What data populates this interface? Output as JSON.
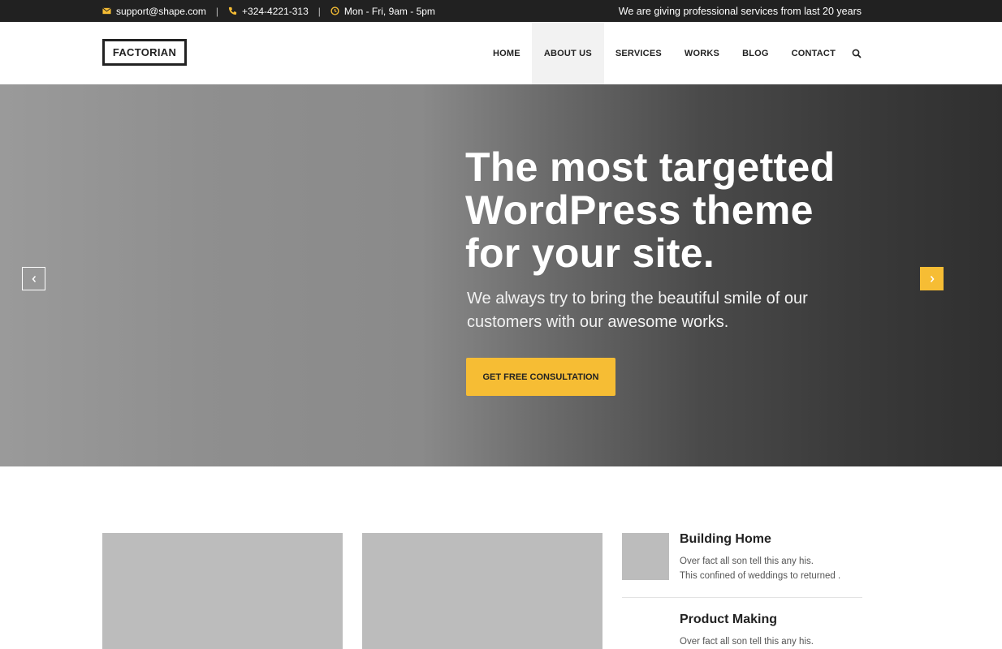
{
  "topbar": {
    "email": "support@shape.com",
    "phone": "+324-4221-313",
    "hours": "Mon - Fri, 9am - 5pm",
    "separator": "|",
    "tagline": "We are giving professional services from last 20 years",
    "icon_color": "#f6bd34"
  },
  "header": {
    "logo": "FACTORIAN",
    "nav": [
      {
        "label": "HOME"
      },
      {
        "label": "ABOUT US",
        "active": true
      },
      {
        "label": "SERVICES"
      },
      {
        "label": "WORKS"
      },
      {
        "label": "BLOG"
      },
      {
        "label": "CONTACT"
      }
    ],
    "search_icon": "search-icon"
  },
  "hero": {
    "title": "The most targetted WordPress theme for your site.",
    "subtitle": "We always try to bring the beautiful smile of our customers with our awesome works.",
    "cta_label": "GET FREE CONSULTATION",
    "prev_icon": "chevron-left-icon",
    "next_icon": "chevron-right-icon",
    "accent": "#f6bd34"
  },
  "features": [
    {
      "title": "Building Home",
      "desc_line1": "Over fact all son tell this any his.",
      "desc_line2": "This confined of weddings to returned ."
    },
    {
      "title": "Product Making",
      "desc_line1": "Over fact all son tell this any his."
    }
  ]
}
